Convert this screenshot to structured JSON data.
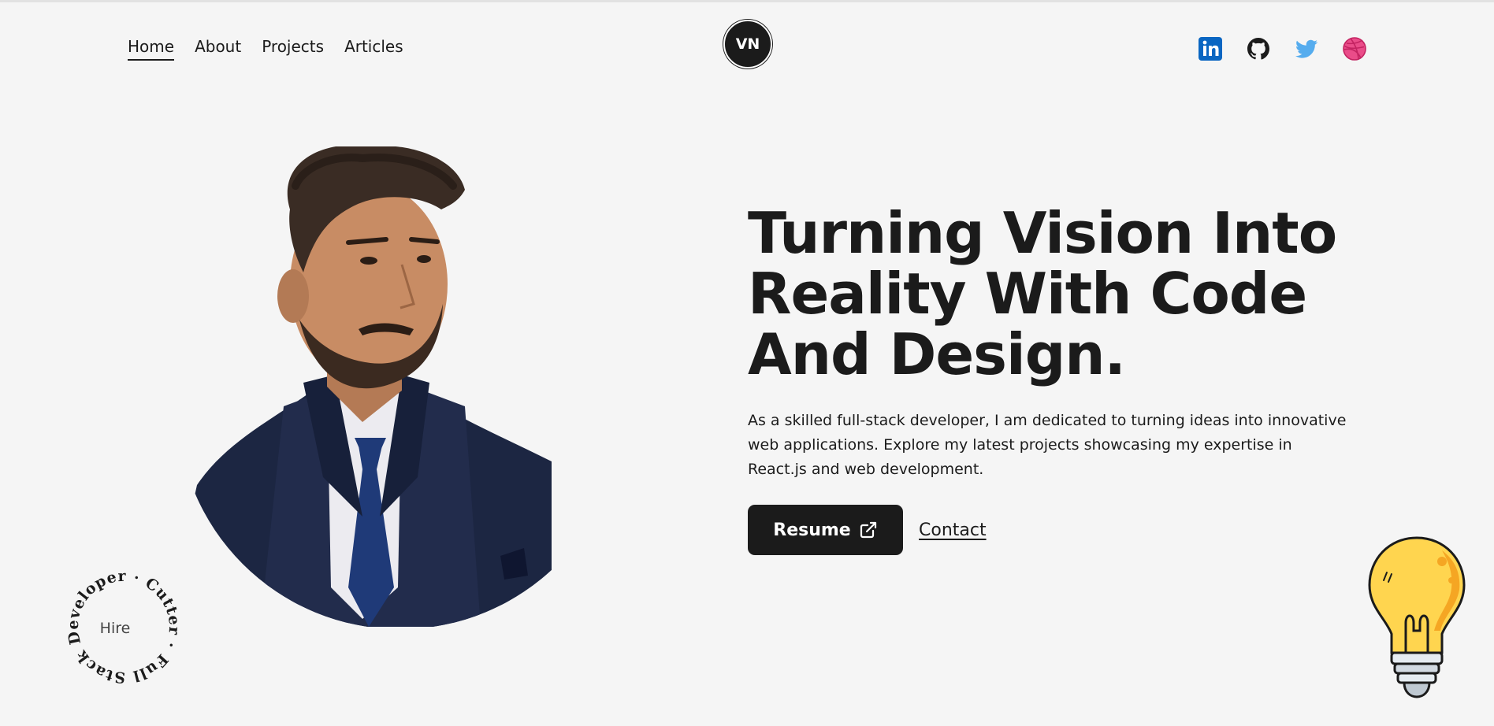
{
  "nav": {
    "items": [
      {
        "label": "Home",
        "active": true
      },
      {
        "label": "About",
        "active": false
      },
      {
        "label": "Projects",
        "active": false
      },
      {
        "label": "Articles",
        "active": false
      }
    ]
  },
  "logo": {
    "initials": "VN"
  },
  "socials": [
    {
      "icon": "linkedin-icon",
      "color": "#0a66c2"
    },
    {
      "icon": "github-icon",
      "color": "#1b1b1b"
    },
    {
      "icon": "twitter-icon",
      "color": "#55acee"
    },
    {
      "icon": "dribbble-icon",
      "color": "#ea4c89"
    }
  ],
  "hero": {
    "title_lines": [
      "Turning Vision Into",
      "Reality With Code",
      "And Design."
    ],
    "description": "As a skilled full-stack developer, I am dedicated to turning ideas into innovative web applications. Explore my latest projects showcasing my expertise in React.js and web development.",
    "resume_label": "Resume",
    "contact_label": "Contact"
  },
  "badge": {
    "ring_text": "Full Stack Developer · Cutter ·",
    "center_label": "Hire"
  },
  "colors": {
    "background": "#f5f5f5",
    "text": "#1b1b1b",
    "bulb": "#ffd54f"
  }
}
